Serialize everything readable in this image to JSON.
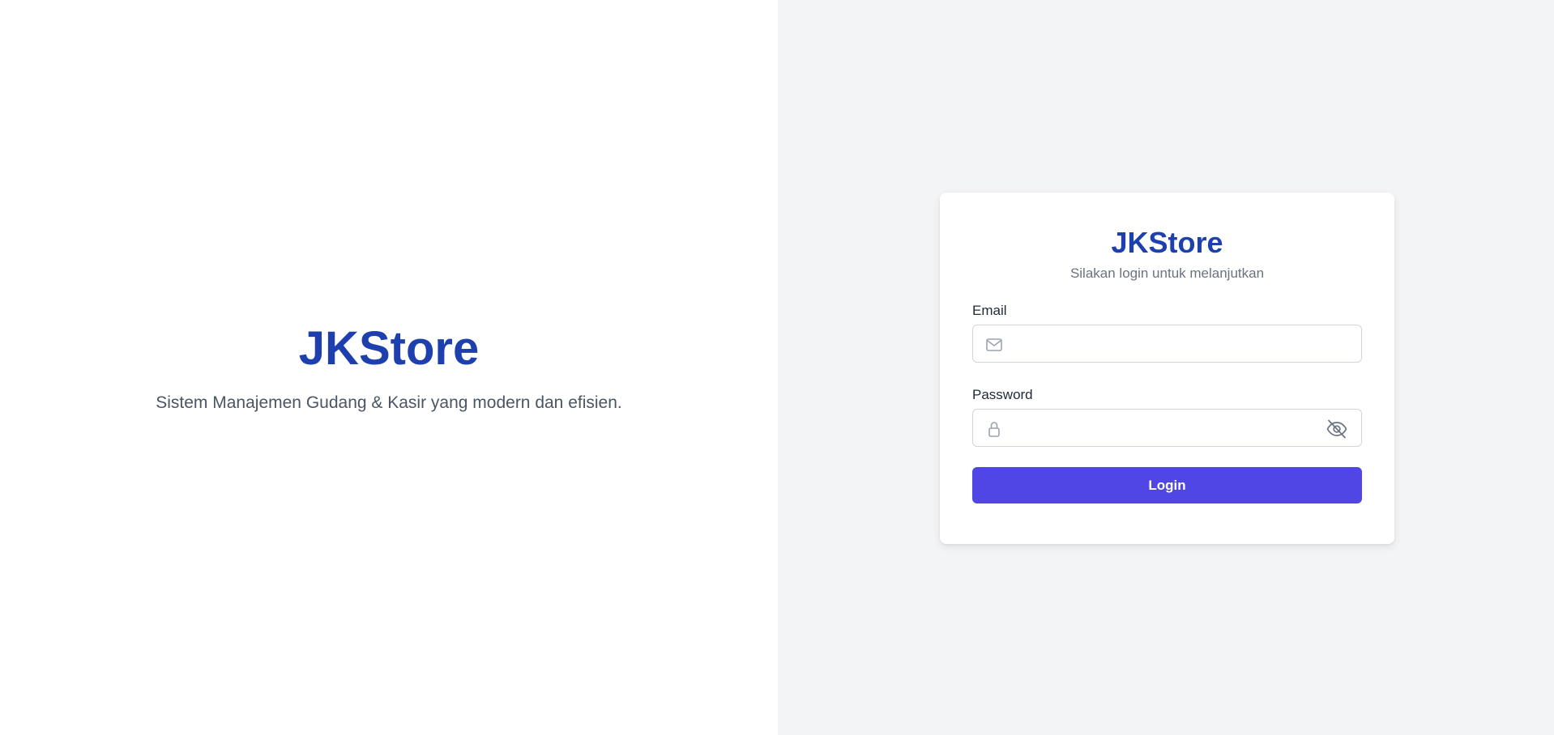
{
  "hero": {
    "title": "JKStore",
    "tagline": "Sistem Manajemen Gudang & Kasir yang modern dan efisien."
  },
  "login_card": {
    "title": "JKStore",
    "subtitle": "Silakan login untuk melanjutkan",
    "email": {
      "label": "Email",
      "value": "",
      "icon": "mail-icon"
    },
    "password": {
      "label": "Password",
      "value": "",
      "icon": "lock-icon",
      "toggle_icon": "eye-off-icon"
    },
    "submit_label": "Login"
  },
  "colors": {
    "brand": "#1e40af",
    "button": "#4f46e5",
    "right_background": "#f3f4f6",
    "left_background": "#ffffff"
  }
}
